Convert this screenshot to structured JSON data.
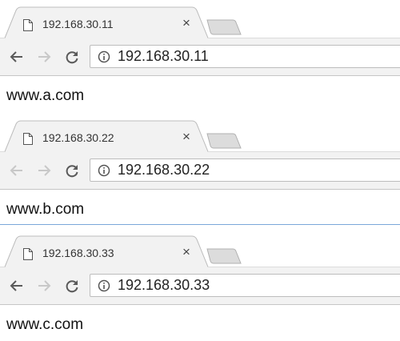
{
  "browsers": [
    {
      "tab_title": "192.168.30.11",
      "url": "192.168.30.11",
      "page_text": "www.a.com",
      "back_enabled": true
    },
    {
      "tab_title": "192.168.30.22",
      "url": "192.168.30.22",
      "page_text": "www.b.com",
      "back_enabled": false
    },
    {
      "tab_title": "192.168.30.33",
      "url": "192.168.30.33",
      "page_text": "www.c.com",
      "back_enabled": true
    }
  ],
  "icons": {
    "favicon": "page-icon",
    "close": "×",
    "back": "arrow-left-icon",
    "forward": "arrow-right-icon",
    "reload": "reload-icon",
    "info": "info-icon"
  },
  "colors": {
    "toolbar_bg": "#f2f2f2",
    "tab_border": "#bdbdbd",
    "icon_active": "#5a5a5a",
    "icon_disabled": "#c8c8c8"
  }
}
